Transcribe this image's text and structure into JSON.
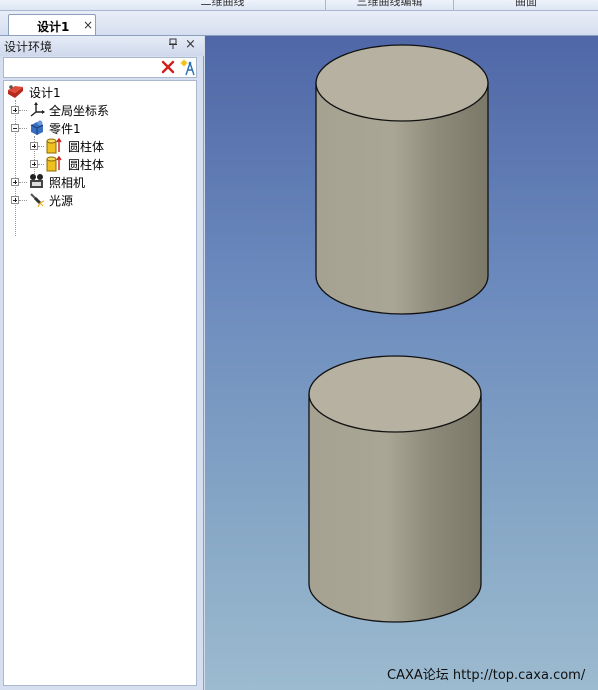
{
  "ribbon_tabs": [
    "二维曲线",
    "三维曲线编辑",
    "曲面"
  ],
  "document_tab": {
    "label": "设计1",
    "close_glyph": "×"
  },
  "panel": {
    "title": "设计环境",
    "pin_glyph": "ᵖ",
    "close_glyph": "×",
    "toolbar": {
      "delete_icon": "delete-icon",
      "wizard_icon": "wizard-icon"
    }
  },
  "tree": {
    "root": "设计1",
    "global_cs": "全局坐标系",
    "part": "零件1",
    "cylinder_1": "圆柱体",
    "cylinder_2": "圆柱体",
    "camera": "照相机",
    "light": "光源"
  },
  "viewport": {
    "background_top": "#4f67a7",
    "background_bottom": "#9cbbd0",
    "objects": [
      "cylinder",
      "cylinder"
    ],
    "watermark": "CAXA论坛 http://top.caxa.com/"
  },
  "colors": {
    "cylinder_top": "#b6b1a0",
    "cylinder_side_light": "#aaa696",
    "cylinder_side_dark": "#7d7a6a"
  }
}
